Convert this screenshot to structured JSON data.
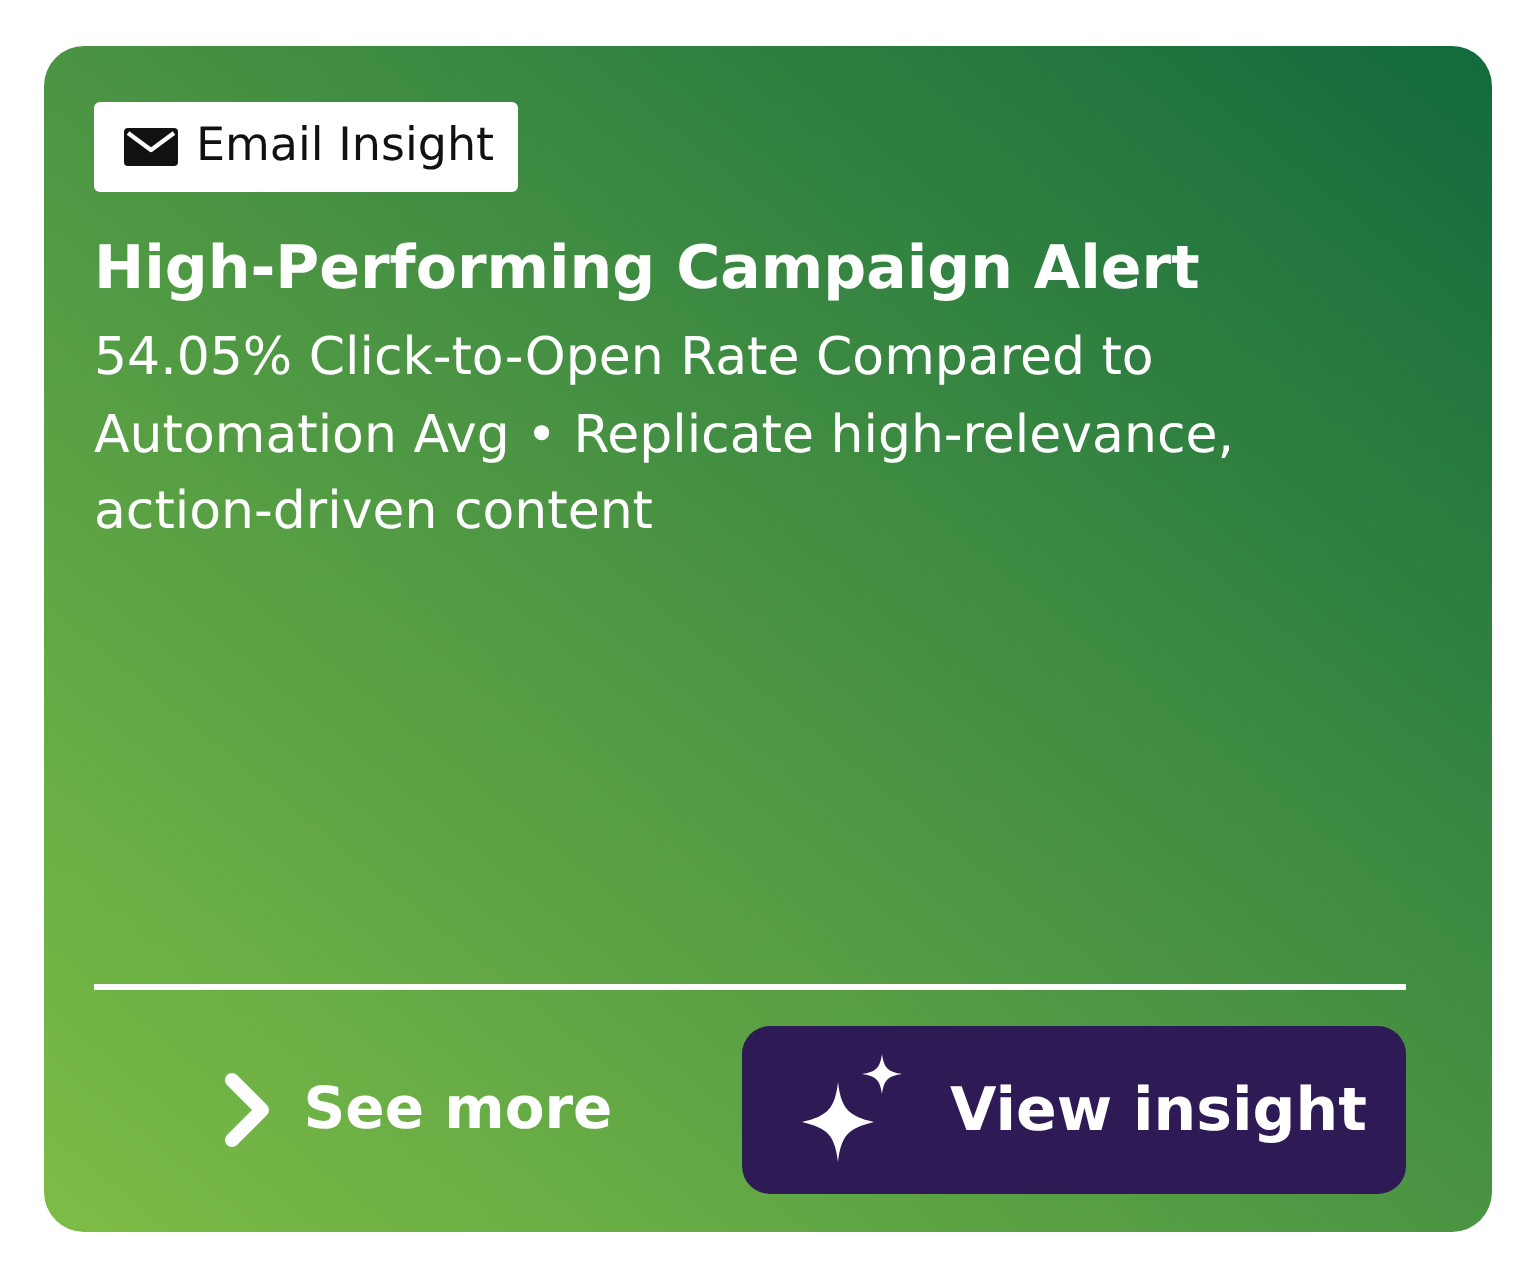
{
  "card": {
    "badge": {
      "label": "Email Insight"
    },
    "title": "High-Performing Campaign Alert",
    "description": "54.05% Click-to-Open Rate Compared to Automation Avg • Replicate high-relevance, action-driven content",
    "actions": [
      {
        "kind": "link",
        "label": "See more"
      },
      {
        "kind": "primary",
        "label": "View insight"
      }
    ]
  }
}
